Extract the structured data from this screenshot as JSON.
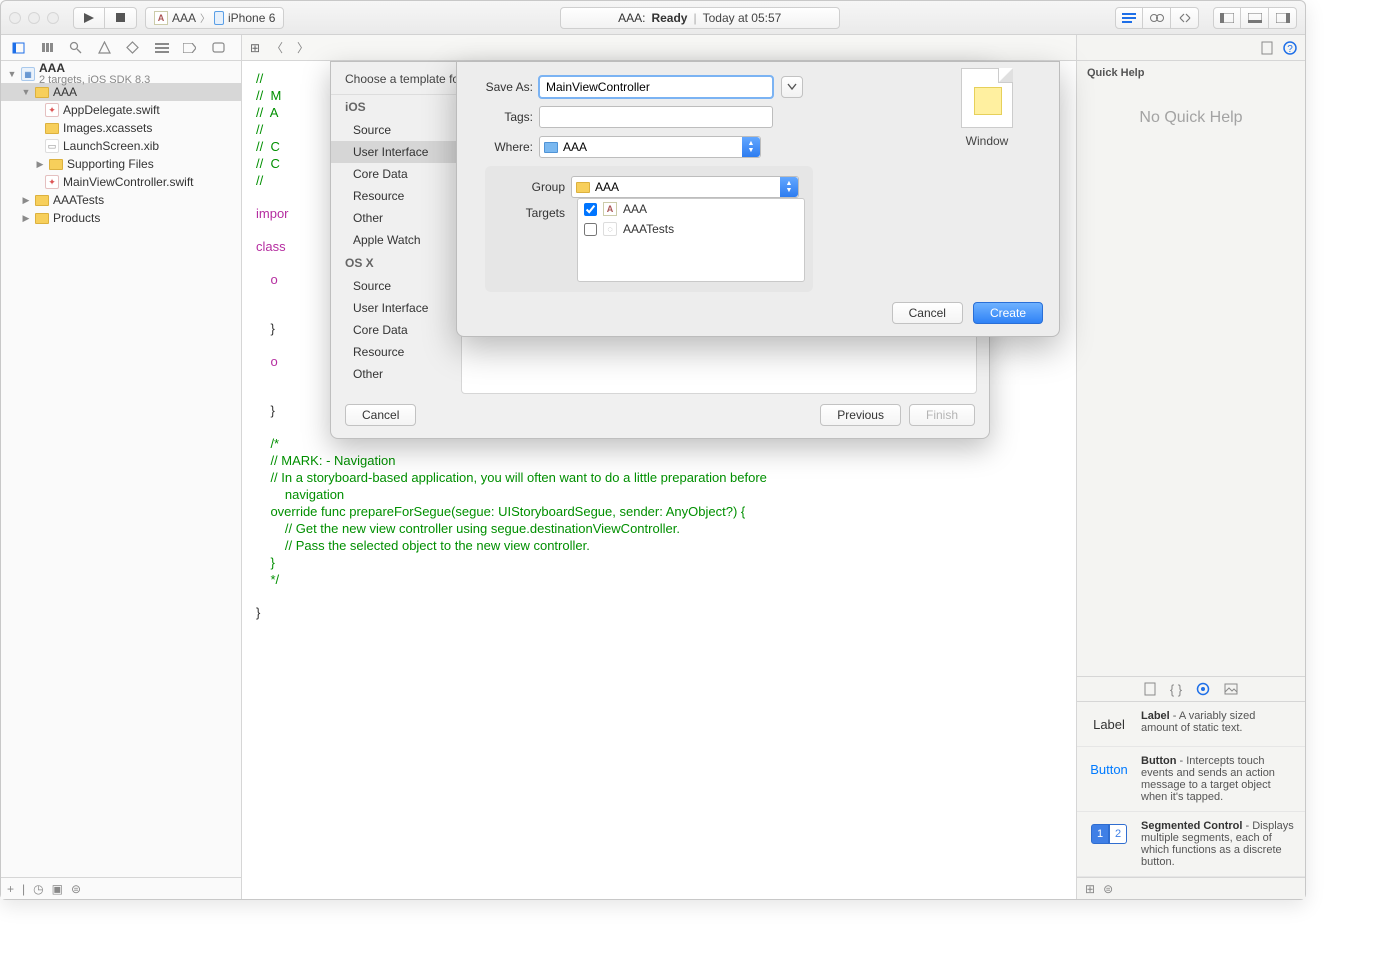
{
  "titlebar": {
    "scheme_project": "AAA",
    "scheme_device": "iPhone 6",
    "status_project": "AAA:",
    "status_state": "Ready",
    "status_time": "Today at 05:57"
  },
  "navigator": {
    "project_name": "AAA",
    "project_sub": "2 targets, iOS SDK 8.3",
    "root_folder": "AAA",
    "files": {
      "appdelegate": "AppDelegate.swift",
      "images": "Images.xcassets",
      "launchscreen": "LaunchScreen.xib",
      "supporting": "Supporting Files",
      "mainvc": "MainViewController.swift"
    },
    "tests_folder": "AAATests",
    "products_folder": "Products"
  },
  "code": {
    "l1": "//",
    "l2": "//  M",
    "l3": "//  A",
    "l4": "//",
    "l5": "//  C",
    "l6": "//  C",
    "l7": "//",
    "import_kw": "impor",
    "class_kw": "class",
    "override1_indent": "    o",
    "brace1": "    }",
    "override2_indent": "    o",
    "brace2": "    }",
    "nav_head": "    /*\n    // MARK: - Navigation",
    "nav_body": "\n    // In a storyboard-based application, you will often want to do a little preparation before\n        navigation\n    override func prepareForSegue(segue: UIStoryboardSegue, sender: AnyObject?) {\n        // Get the new view controller using segue.destinationViewController.\n        // Pass the selected object to the new view controller.\n    }\n    */",
    "close_brace": "}"
  },
  "quick_help": {
    "title": "Quick Help",
    "empty": "No Quick Help"
  },
  "library": {
    "items": [
      {
        "name": "Label",
        "desc": " - A variably sized amount of static text."
      },
      {
        "name": "Button",
        "desc": " - Intercepts touch events and sends an action message to a target object when it's tapped."
      },
      {
        "name": "Segmented Control",
        "desc": " - Displays multiple segments, each of which functions as a discrete button."
      }
    ]
  },
  "template_sheet": {
    "title": "Choose a template fo",
    "ios_header": "iOS",
    "osx_header": "OS X",
    "items": {
      "source": "Source",
      "ui": "User Interface",
      "coredata": "Core Data",
      "resource": "Resource",
      "other": "Other",
      "watch": "Apple Watch"
    },
    "cancel": "Cancel",
    "previous": "Previous",
    "finish": "Finish"
  },
  "save_sheet": {
    "save_as_label": "Save As:",
    "save_as_value": "MainViewController",
    "tags_label": "Tags:",
    "where_label": "Where:",
    "where_value": "AAA",
    "group_label": "Group",
    "group_value": "AAA",
    "targets_label": "Targets",
    "target1": "AAA",
    "target2": "AAATests",
    "template_caption": "Window",
    "cancel": "Cancel",
    "create": "Create"
  }
}
